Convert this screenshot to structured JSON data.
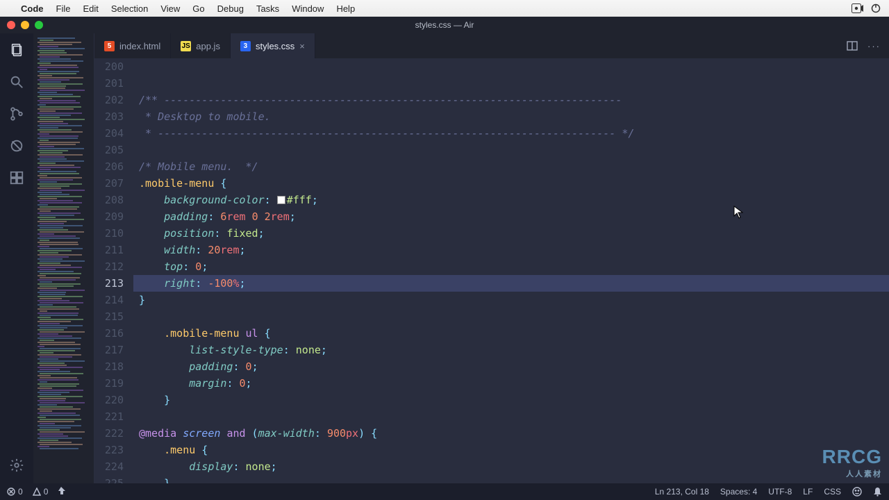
{
  "menubar": {
    "apple": "",
    "app": "Code",
    "items": [
      "File",
      "Edit",
      "Selection",
      "View",
      "Go",
      "Debug",
      "Tasks",
      "Window",
      "Help"
    ]
  },
  "window": {
    "title": "styles.css — Air"
  },
  "tabs": [
    {
      "label": "index.html",
      "icon_bg": "#e44d26",
      "icon_text": "5",
      "active": false,
      "dirty": false
    },
    {
      "label": "app.js",
      "icon_bg": "#f0db4f",
      "icon_text": "JS",
      "active": false,
      "dirty": false
    },
    {
      "label": "styles.css",
      "icon_bg": "#2965f1",
      "icon_text": "3",
      "active": true,
      "dirty": true
    }
  ],
  "editor": {
    "first_line": 200,
    "active_line": 213,
    "lines": [
      {
        "raw": ""
      },
      {
        "raw": ""
      },
      {
        "tokens": [
          [
            "comment",
            "/** -------------------------------------------------------------------------"
          ]
        ]
      },
      {
        "tokens": [
          [
            "comment",
            " * Desktop to mobile."
          ]
        ]
      },
      {
        "tokens": [
          [
            "comment",
            " * ------------------------------------------------------------------------- */"
          ]
        ]
      },
      {
        "raw": ""
      },
      {
        "tokens": [
          [
            "comment",
            "/* Mobile menu.  */"
          ]
        ]
      },
      {
        "tokens": [
          [
            "selector",
            ".mobile-menu"
          ],
          [
            "punct",
            " {"
          ]
        ]
      },
      {
        "tokens": [
          [
            "indent",
            "    "
          ],
          [
            "prop",
            "background-color"
          ],
          [
            "punct",
            ": "
          ],
          [
            "swatch",
            ""
          ],
          [
            "str",
            "#fff"
          ],
          [
            "punct",
            ";"
          ]
        ]
      },
      {
        "tokens": [
          [
            "indent",
            "    "
          ],
          [
            "prop",
            "padding"
          ],
          [
            "punct",
            ": "
          ],
          [
            "num",
            "6"
          ],
          [
            "unit",
            "rem"
          ],
          [
            "punct",
            " "
          ],
          [
            "num",
            "0"
          ],
          [
            "punct",
            " "
          ],
          [
            "num",
            "2"
          ],
          [
            "unit",
            "rem"
          ],
          [
            "punct",
            ";"
          ]
        ]
      },
      {
        "tokens": [
          [
            "indent",
            "    "
          ],
          [
            "prop",
            "position"
          ],
          [
            "punct",
            ": "
          ],
          [
            "str",
            "fixed"
          ],
          [
            "punct",
            ";"
          ]
        ]
      },
      {
        "tokens": [
          [
            "indent",
            "    "
          ],
          [
            "prop",
            "width"
          ],
          [
            "punct",
            ": "
          ],
          [
            "num",
            "20"
          ],
          [
            "unit",
            "rem"
          ],
          [
            "punct",
            ";"
          ]
        ]
      },
      {
        "tokens": [
          [
            "indent",
            "    "
          ],
          [
            "prop",
            "top"
          ],
          [
            "punct",
            ": "
          ],
          [
            "num",
            "0"
          ],
          [
            "punct",
            ";"
          ]
        ]
      },
      {
        "tokens": [
          [
            "indent",
            "    "
          ],
          [
            "prop",
            "right"
          ],
          [
            "punct",
            ": "
          ],
          [
            "num",
            "-100"
          ],
          [
            "unit",
            "%"
          ],
          [
            "punct",
            ";"
          ]
        ],
        "hl": true
      },
      {
        "tokens": [
          [
            "punct",
            "}"
          ]
        ]
      },
      {
        "raw": ""
      },
      {
        "tokens": [
          [
            "indent",
            "    "
          ],
          [
            "selector",
            ".mobile-menu "
          ],
          [
            "keyword",
            "ul"
          ],
          [
            "punct",
            " {"
          ]
        ]
      },
      {
        "tokens": [
          [
            "indent",
            "        "
          ],
          [
            "prop",
            "list-style-type"
          ],
          [
            "punct",
            ": "
          ],
          [
            "str",
            "none"
          ],
          [
            "punct",
            ";"
          ]
        ]
      },
      {
        "tokens": [
          [
            "indent",
            "        "
          ],
          [
            "prop",
            "padding"
          ],
          [
            "punct",
            ": "
          ],
          [
            "num",
            "0"
          ],
          [
            "punct",
            ";"
          ]
        ]
      },
      {
        "tokens": [
          [
            "indent",
            "        "
          ],
          [
            "prop",
            "margin"
          ],
          [
            "punct",
            ": "
          ],
          [
            "num",
            "0"
          ],
          [
            "punct",
            ";"
          ]
        ]
      },
      {
        "tokens": [
          [
            "indent",
            "    "
          ],
          [
            "punct",
            "}"
          ]
        ]
      },
      {
        "raw": ""
      },
      {
        "tokens": [
          [
            "keyword",
            "@media"
          ],
          [
            "punct",
            " "
          ],
          [
            "func",
            "screen"
          ],
          [
            "punct",
            " "
          ],
          [
            "keyword",
            "and"
          ],
          [
            "punct",
            " ("
          ],
          [
            "prop",
            "max-width"
          ],
          [
            "punct",
            ": "
          ],
          [
            "num",
            "900"
          ],
          [
            "unit",
            "px"
          ],
          [
            "punct",
            ") {"
          ]
        ]
      },
      {
        "tokens": [
          [
            "indent",
            "    "
          ],
          [
            "selector",
            ".menu"
          ],
          [
            "punct",
            " {"
          ]
        ]
      },
      {
        "tokens": [
          [
            "indent",
            "        "
          ],
          [
            "prop",
            "display"
          ],
          [
            "punct",
            ": "
          ],
          [
            "str",
            "none"
          ],
          [
            "punct",
            ";"
          ]
        ]
      },
      {
        "tokens": [
          [
            "indent",
            "    "
          ],
          [
            "punct",
            "}"
          ]
        ]
      }
    ]
  },
  "statusbar": {
    "errors": "0",
    "warnings": "0",
    "line_col": "Ln 213, Col 18",
    "spaces": "Spaces: 4",
    "encoding": "UTF-8",
    "eol": "LF",
    "lang": "CSS"
  },
  "watermark": {
    "big": "RRCG",
    "small": "人人素材"
  }
}
